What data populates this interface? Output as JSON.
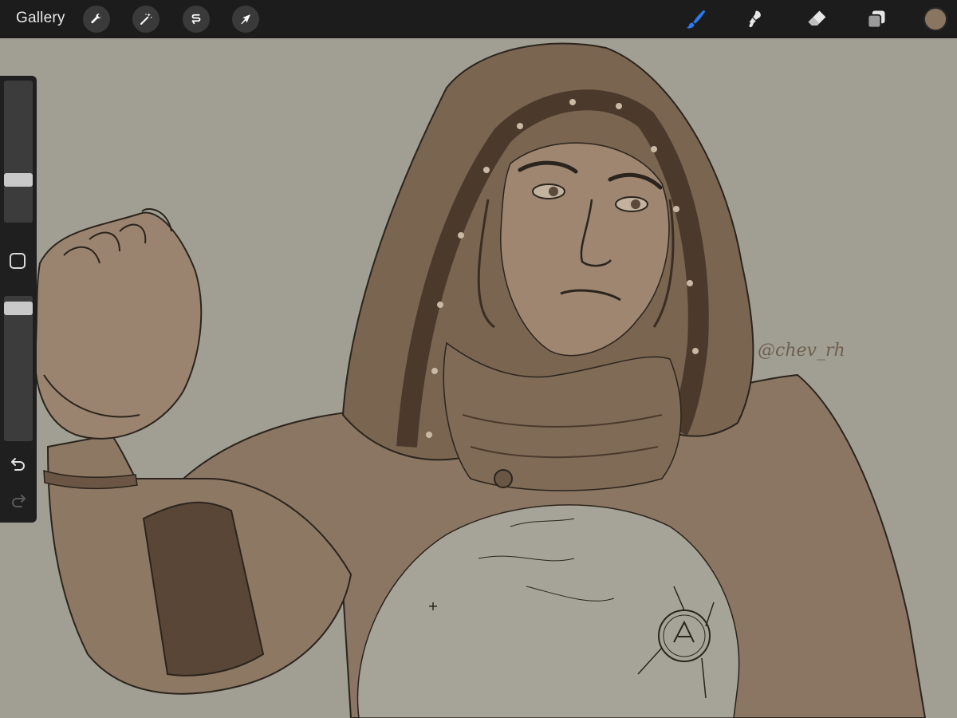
{
  "toolbar": {
    "gallery_label": "Gallery",
    "left_tools": [
      "wrench-icon",
      "magic-wand-icon",
      "selection-icon",
      "transform-arrow-icon"
    ],
    "right_tools": [
      "brush-icon",
      "smudge-icon",
      "eraser-icon",
      "layers-icon"
    ],
    "active_tool": "brush",
    "active_color": "#8a7560"
  },
  "sidebar": {
    "brush_size_level": 0.28,
    "opacity_level": 0.96
  },
  "canvas": {
    "background": "#a19f93",
    "signature": "@chev_rh"
  }
}
